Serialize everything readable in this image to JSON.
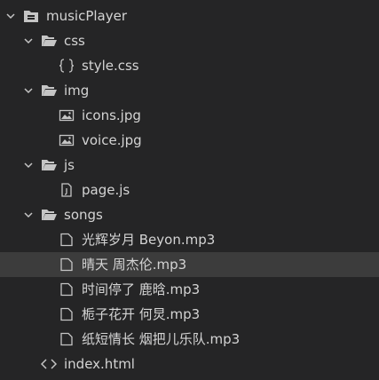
{
  "explorer": {
    "root": {
      "label": "musicPlayer",
      "icon": "folder-open-icon",
      "expanded": true
    },
    "items": [
      {
        "label": "css",
        "icon": "folder-open-icon",
        "type": "folder",
        "expanded": true,
        "depth": 1
      },
      {
        "label": "style.css",
        "icon": "braces-icon",
        "type": "file",
        "depth": 2
      },
      {
        "label": "img",
        "icon": "folder-open-icon",
        "type": "folder",
        "expanded": true,
        "depth": 1
      },
      {
        "label": "icons.jpg",
        "icon": "image-icon",
        "type": "file",
        "depth": 2
      },
      {
        "label": "voice.jpg",
        "icon": "image-icon",
        "type": "file",
        "depth": 2
      },
      {
        "label": "js",
        "icon": "folder-open-icon",
        "type": "folder",
        "expanded": true,
        "depth": 1
      },
      {
        "label": "page.js",
        "icon": "file-icon",
        "type": "file",
        "depth": 2
      },
      {
        "label": "songs",
        "icon": "folder-open-icon",
        "type": "folder",
        "expanded": true,
        "depth": 1
      },
      {
        "label": "光辉岁月 Beyon.mp3",
        "icon": "document-icon",
        "type": "file",
        "depth": 2
      },
      {
        "label": "晴天 周杰伦.mp3",
        "icon": "document-icon",
        "type": "file",
        "depth": 2,
        "selected": true
      },
      {
        "label": "时间停了 鹿晗.mp3",
        "icon": "document-icon",
        "type": "file",
        "depth": 2
      },
      {
        "label": "栀子花开 何炅.mp3",
        "icon": "document-icon",
        "type": "file",
        "depth": 2
      },
      {
        "label": "纸短情长 烟把儿乐队.mp3",
        "icon": "document-icon",
        "type": "file",
        "depth": 2
      },
      {
        "label": "index.html",
        "icon": "code-brackets-icon",
        "type": "file",
        "depth": 1
      }
    ]
  },
  "colors": {
    "background": "#252526",
    "selected_row": "#3c3c3c",
    "text": "#d4d4d4",
    "icon": "#c5c5c5"
  }
}
